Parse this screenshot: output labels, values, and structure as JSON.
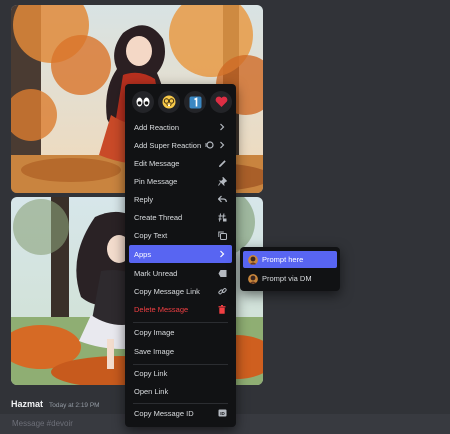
{
  "message": {
    "author": "Hazmat",
    "timestamp": "Today at 2:19 PM"
  },
  "composer": {
    "placeholder": "Message #devoir"
  },
  "context_menu": {
    "quick_reactions": [
      {
        "icon": "eyes-emoji"
      },
      {
        "icon": "nerd-face-emoji"
      },
      {
        "icon": "keycap-one-emoji"
      },
      {
        "icon": "red-heart-emoji"
      }
    ],
    "items": [
      {
        "label": "Add Reaction",
        "icon": "chevron-right-icon"
      },
      {
        "label": "Add Super Reaction",
        "icon": "chevron-right-icon"
      },
      {
        "label": "Edit Message",
        "icon": "pencil-icon"
      },
      {
        "label": "Pin Message",
        "icon": "pin-icon"
      },
      {
        "label": "Reply",
        "icon": "reply-icon"
      },
      {
        "label": "Create Thread",
        "icon": "thread-icon"
      },
      {
        "label": "Copy Text",
        "icon": "copy-icon"
      },
      {
        "label": "Apps",
        "icon": "chevron-right-icon"
      },
      {
        "label": "Mark Unread",
        "icon": "mark-unread-icon"
      },
      {
        "label": "Copy Message Link",
        "icon": "link-icon"
      },
      {
        "label": "Delete Message",
        "icon": "trash-icon"
      },
      {
        "label": "Copy Image"
      },
      {
        "label": "Save Image"
      },
      {
        "label": "Copy Link"
      },
      {
        "label": "Open Link"
      },
      {
        "label": "Copy Message ID",
        "icon": "id-icon"
      }
    ]
  },
  "apps_submenu": {
    "items": [
      {
        "label": "Prompt here"
      },
      {
        "label": "Prompt via DM"
      }
    ]
  },
  "colors": {
    "background": "#313338",
    "menu": "#111214",
    "accent": "#5865f2",
    "danger": "#f23f43"
  }
}
